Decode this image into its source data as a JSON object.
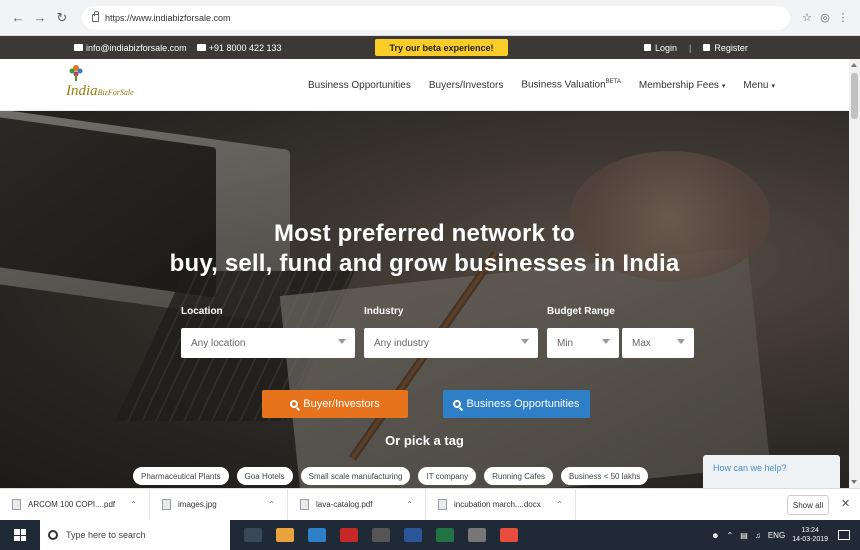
{
  "browser": {
    "url": "https://www.indiabizforsale.com"
  },
  "topbar": {
    "email": "info@indiabizforsale.com",
    "phone": "+91 8000 422 133",
    "beta_label": "Try our beta experience!",
    "login": "Login",
    "register": "Register"
  },
  "logo": {
    "main": "India",
    "sub": "BizForSale"
  },
  "nav": {
    "items": [
      {
        "label": "Business Opportunities"
      },
      {
        "label": "Buyers/Investors"
      },
      {
        "label": "Business Valuation",
        "badge": "BETA"
      },
      {
        "label": "Membership Fees",
        "caret": "▾"
      },
      {
        "label": "Menu",
        "caret": "▾"
      }
    ]
  },
  "hero": {
    "headline_1": "Most preferred network to",
    "headline_2": "buy, sell, fund and grow businesses in India",
    "location_label": "Location",
    "location_value": "Any location",
    "industry_label": "Industry",
    "industry_value": "Any industry",
    "budget_label": "Budget Range",
    "budget_min": "Min",
    "budget_max": "Max",
    "btn_buyers": "Buyer/Investors",
    "btn_opps": "Business Opportunities",
    "pick_tag": "Or pick a tag",
    "tags": [
      "Pharmaceutical Plants",
      "Goa Hotels",
      "Small scale manufacturing",
      "IT company",
      "Running Cafes",
      "Business < 50 lakhs"
    ],
    "help": "How can we help?"
  },
  "downloads": {
    "items": [
      {
        "name": "ARCOM 100 COPI....pdf"
      },
      {
        "name": "images.jpg"
      },
      {
        "name": "lava-catalog.pdf"
      },
      {
        "name": "incubation march....docx"
      }
    ],
    "show_all": "Show all"
  },
  "taskbar": {
    "search": "Type here to search",
    "lang": "ENG",
    "time": "13:24",
    "date": "14-03-2019"
  },
  "colors": {
    "beta_yellow": "#f9cc27",
    "buyers_orange": "#e8731d",
    "opps_blue": "#2e7fc8",
    "topbar_dark": "#3d3835"
  }
}
